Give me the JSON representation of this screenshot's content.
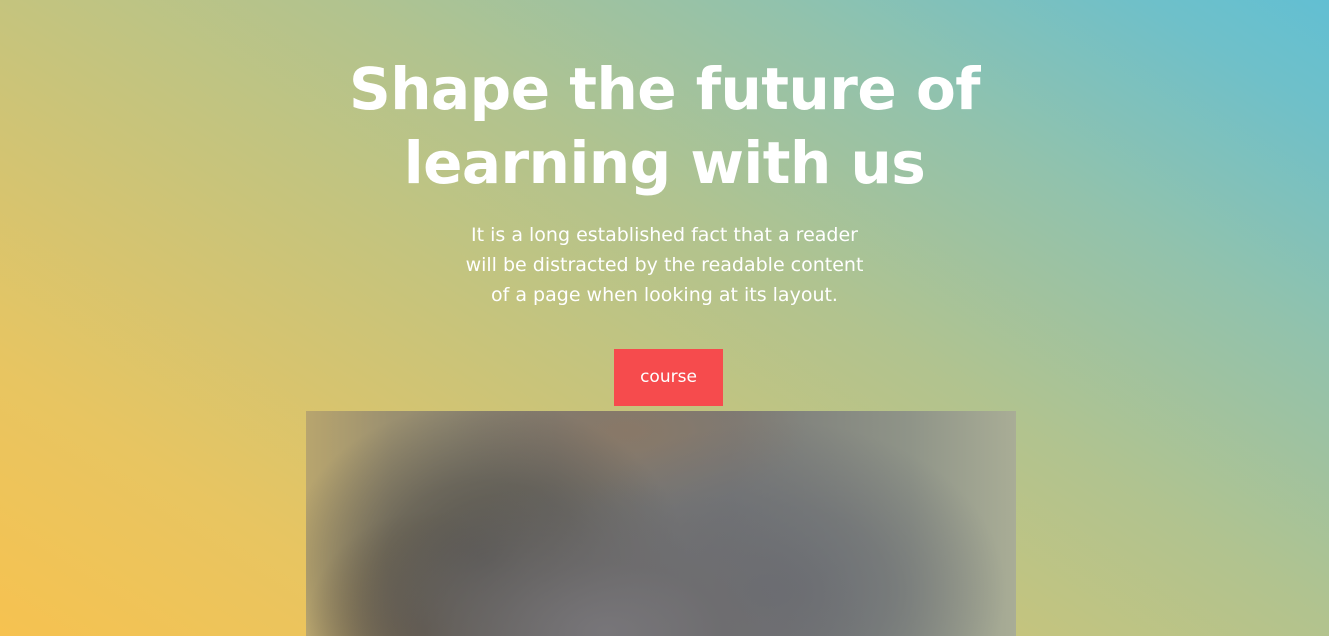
{
  "hero": {
    "headline_line1": "Shape the future of",
    "headline_line2": "learning with us",
    "subtext_line1": "It is a long established fact that a reader",
    "subtext_line2": "will be distracted by the readable content",
    "subtext_line3": "of a page when looking at its layout.",
    "cta_label": "course"
  },
  "colors": {
    "cta_background": "#f64b4d",
    "text": "#ffffff",
    "gradient_warm": "#f6c250",
    "gradient_cool": "#62bfd3"
  },
  "media": {
    "icon": "blurred-photo-image"
  }
}
